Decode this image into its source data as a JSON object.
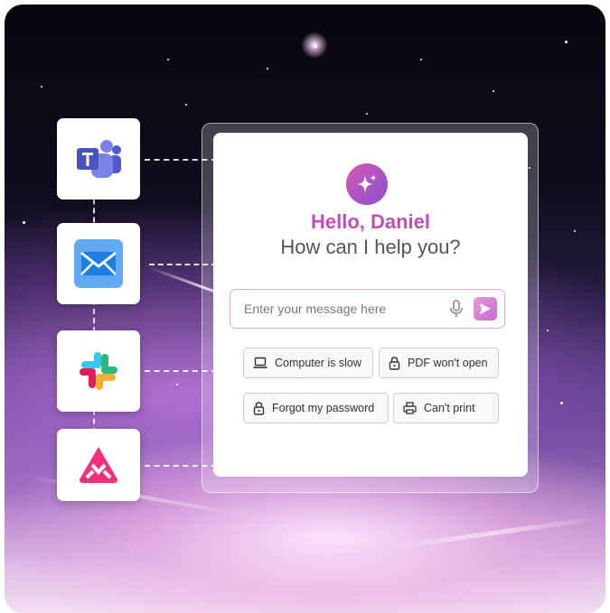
{
  "background": {
    "accent": "#c04fb4"
  },
  "integrations": [
    {
      "name": "Microsoft Teams",
      "icon": "teams-icon"
    },
    {
      "name": "Mail",
      "icon": "mail-icon"
    },
    {
      "name": "Slack",
      "icon": "slack-icon"
    },
    {
      "name": "App",
      "icon": "app-logo-icon"
    }
  ],
  "chat": {
    "icon": "sparkle-icon",
    "greeting": "Hello, Daniel",
    "prompt": "How can I help you?",
    "input_placeholder": "Enter your message here",
    "mic_icon": "microphone-icon",
    "send_icon": "send-icon",
    "suggestions": [
      {
        "label": "Computer is slow",
        "icon": "laptop-icon"
      },
      {
        "label": "PDF won't open",
        "icon": "lock-icon"
      },
      {
        "label": "Forgot my password",
        "icon": "lock-icon"
      },
      {
        "label": "Can't print",
        "icon": "printer-icon"
      }
    ]
  }
}
